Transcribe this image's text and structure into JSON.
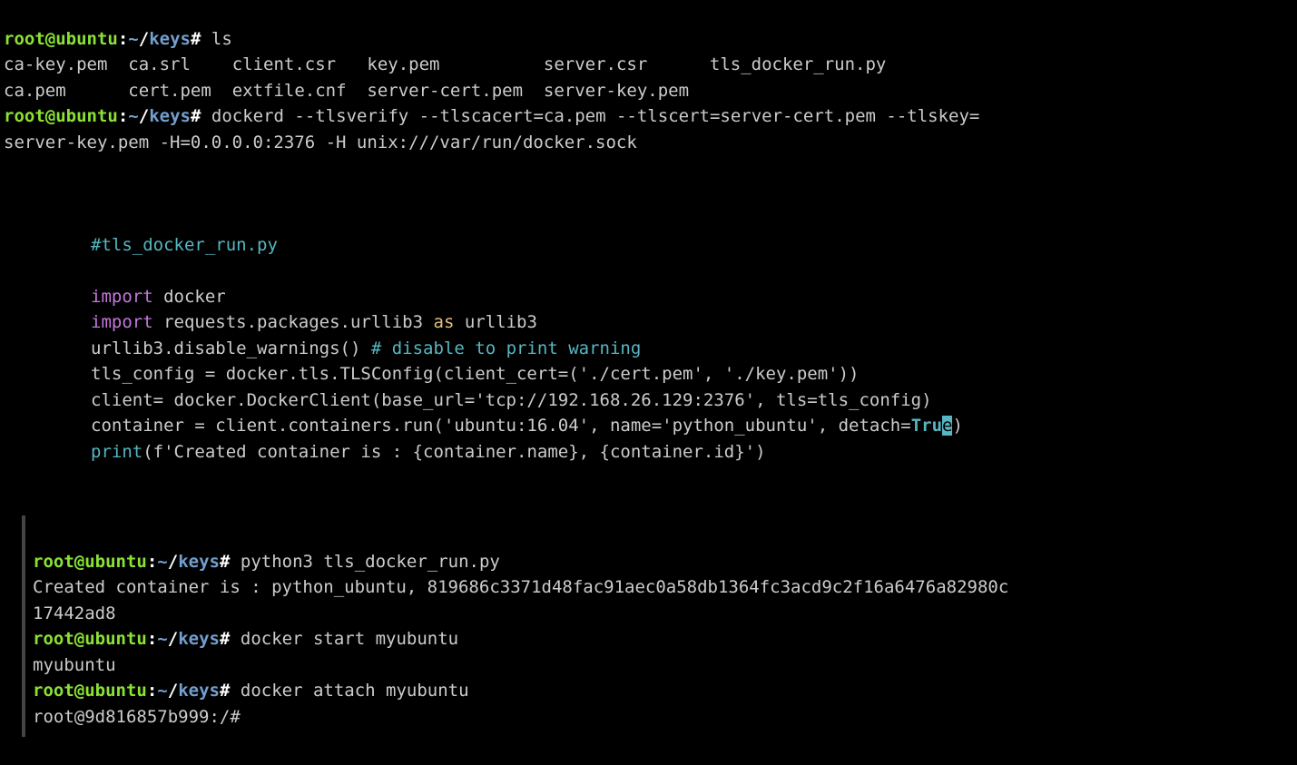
{
  "prompt": {
    "user": "root@ubuntu",
    "sep": ":",
    "tilde": "~",
    "slash": "/",
    "dir": "keys",
    "hash": "#"
  },
  "block1": {
    "cmd_ls": "ls",
    "files": [
      "ca-key.pem",
      "ca.srl",
      "client.csr",
      "key.pem",
      "server.csr",
      "tls_docker_run.py",
      "ca.pem",
      "cert.pem",
      "extfile.cnf",
      "server-cert.pem",
      "server-key.pem"
    ],
    "cmd_dockerd_1": "dockerd --tlsverify --tlscacert=ca.pem --tlscert=server-cert.pem --tlskey=",
    "cmd_dockerd_2": "server-key.pem -H=0.0.0.0:2376 -H unix:///var/run/docker.sock"
  },
  "code": {
    "l1": "#tls_docker_run.py",
    "l3_import": "import",
    "l3_rest": " docker",
    "l4_import": "import",
    "l4_mod": " requests.packages.urllib3 ",
    "l4_as": "as",
    "l4_alias": " urllib3",
    "l5": "urllib3.disable_warnings() ",
    "l5_comment": "# disable to print warning",
    "l6": "tls_config = docker.tls.TLSConfig(client_cert=('./cert.pem', './key.pem'))",
    "l7": "client= docker.DockerClient(base_url='tcp://192.168.26.129:2376', tls=tls_config)",
    "l8": "container = client.containers.run('ubuntu:16.04', name='python_ubuntu', detach=",
    "l8_true_a": "Tru",
    "l8_true_b": "e",
    "l8_end": ")",
    "l9_print": "print",
    "l9_rest": "(f'Created container is : {container.name}, {container.id}')"
  },
  "block2": {
    "cmd_py": "python3 tls_docker_run.py",
    "out_py_1": "Created container is : python_ubuntu, 819686c3371d48fac91aec0a58db1364fc3acd9c2f16a6476a82980c",
    "out_py_2": "17442ad8",
    "cmd_start": "docker start myubuntu",
    "out_start": "myubuntu",
    "cmd_attach": "docker attach myubuntu",
    "out_attach": "root@9d816857b999:/#"
  }
}
